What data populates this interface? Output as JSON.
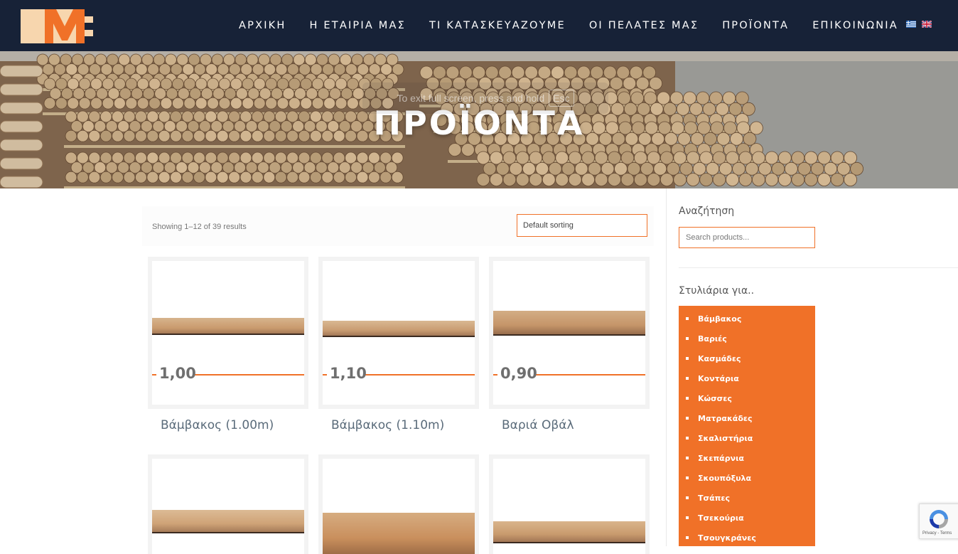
{
  "header": {
    "logo_text": "ME",
    "nav": [
      "ΑΡΧΙΚΗ",
      "Η ΕΤΑΙΡΙΑ ΜΑΣ",
      "ΤΙ ΚΑΤΑΣΚΕΥΑΖΟΥΜΕ",
      "ΟΙ ΠΕΛΑΤΕΣ ΜΑΣ",
      "ΠΡΟΪΟΝΤΑ",
      "ΕΠΙΚΟΙΝΩΝΙΑ"
    ],
    "languages": [
      "greek-flag-icon",
      "uk-flag-icon"
    ]
  },
  "hero": {
    "title": "ΠΡΟΪΟΝΤΑ",
    "fullscreen_notice": "To exit full screen, press and hold",
    "fullscreen_key": "Esc"
  },
  "shop": {
    "result_count": "Showing 1–12 of 39 results",
    "sorting_selected": "Default sorting",
    "products": [
      {
        "label": "1,00",
        "title": "Βάμβακος (1.00m)"
      },
      {
        "label": "1,10",
        "title": "Βάμβακος (1.10m)"
      },
      {
        "label": "0,90",
        "title": "Βαριά Οβάλ"
      },
      {
        "label": "",
        "title": ""
      },
      {
        "label": "",
        "title": ""
      },
      {
        "label": "",
        "title": ""
      }
    ]
  },
  "sidebar": {
    "search_heading": "Αναζήτηση",
    "search_placeholder": "Search products...",
    "categories_heading": "Στυλιάρια για..",
    "categories": [
      "Βάμβακος",
      "Βαριές",
      "Κασμάδες",
      "Κοντάρια",
      "Κώσσες",
      "Ματρακάδες",
      "Σκαλιστήρια",
      "Σκεπάρνια",
      "Σκουπόξυλα",
      "Τσάπες",
      "Τσεκούρια",
      "Τσουγκράνες"
    ]
  },
  "recaptcha": {
    "text": "Privacy - Terms"
  },
  "colors": {
    "accent": "#f07128",
    "header_bg": "#172237"
  }
}
